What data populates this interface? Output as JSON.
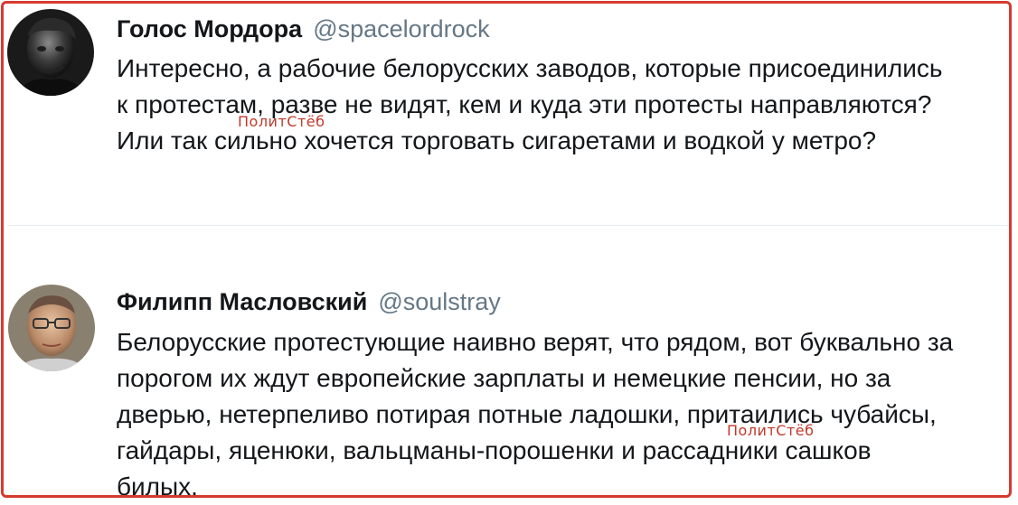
{
  "tweets": [
    {
      "author_name": "Голос Мордора",
      "handle": "@spacelordrock",
      "text_lines": [
        "Интересно, а рабочие белорусских заводов, которые присоединились",
        "к протестам, разве не видят, кем и куда эти протесты направляются?",
        "Или так сильно хочется торговать сигаретами и водкой у метро?"
      ]
    },
    {
      "author_name": "Филипп Масловский",
      "handle": "@soulstray",
      "text_lines": [
        "Белорусские протестующие наивно верят, что рядом, вот буквально за",
        "порогом их ждут европейские зарплаты и немецкие пенсии, но за",
        "дверью, нетерпеливо потирая потные ладошки, притаились чубайсы,",
        "гайдары, яценюки, вальцманы-порошенки и рассадники сашков",
        "билых."
      ]
    }
  ],
  "watermark": "ПолитСтёб",
  "colors": {
    "border": "#d63a2f",
    "name": "#14171a",
    "handle": "#657786",
    "watermark": "#c0392b"
  }
}
